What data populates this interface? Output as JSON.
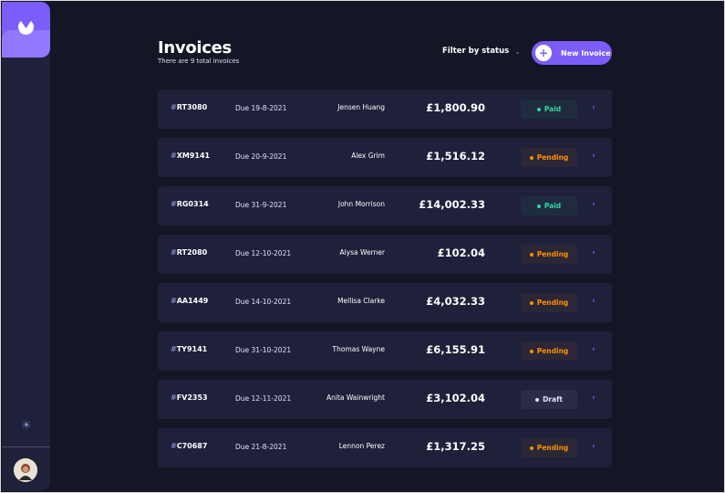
{
  "header": {
    "title": "Invoices",
    "subtitle": "There are 9 total invoices",
    "filter_label": "Filter by status",
    "new_invoice_label": "New Invoice"
  },
  "icons": {
    "logo": "logo-icon",
    "theme": "sun-icon",
    "filter_chevron": "chevron-down-icon",
    "new_invoice": "plus-icon",
    "row_arrow": "chevron-right-icon",
    "avatar": "user-avatar"
  },
  "colors": {
    "accent": "#7c5dfa",
    "paid": "#33d69f",
    "pending": "#ff8f00",
    "draft": "#dfe3fa",
    "background": "#141625",
    "card": "#1e2139"
  },
  "invoices": [
    {
      "id": "RT3080",
      "due": "Due 19-8-2021",
      "client": "Jensen Huang",
      "amount": "£1,800.90",
      "status": "Paid",
      "status_key": "paid"
    },
    {
      "id": "XM9141",
      "due": "Due 20-9-2021",
      "client": "Alex Grim",
      "amount": "£1,516.12",
      "status": "Pending",
      "status_key": "pending"
    },
    {
      "id": "RG0314",
      "due": "Due 31-9-2021",
      "client": "John Morrison",
      "amount": "£14,002.33",
      "status": "Paid",
      "status_key": "paid"
    },
    {
      "id": "RT2080",
      "due": "Due 12-10-2021",
      "client": "Alysa Werner",
      "amount": "£102.04",
      "status": "Pending",
      "status_key": "pending"
    },
    {
      "id": "AA1449",
      "due": "Due 14-10-2021",
      "client": "Mellisa Clarke",
      "amount": "£4,032.33",
      "status": "Pending",
      "status_key": "pending"
    },
    {
      "id": "TY9141",
      "due": "Due 31-10-2021",
      "client": "Thomas Wayne",
      "amount": "£6,155.91",
      "status": "Pending",
      "status_key": "pending"
    },
    {
      "id": "FV2353",
      "due": "Due 12-11-2021",
      "client": "Anita Wainwright",
      "amount": "£3,102.04",
      "status": "Draft",
      "status_key": "draft"
    },
    {
      "id": "C70687",
      "due": "Due 21-8-2021",
      "client": "Lennon Perez",
      "amount": "£1,317.25",
      "status": "Pending",
      "status_key": "pending"
    }
  ],
  "row_hash": "#"
}
